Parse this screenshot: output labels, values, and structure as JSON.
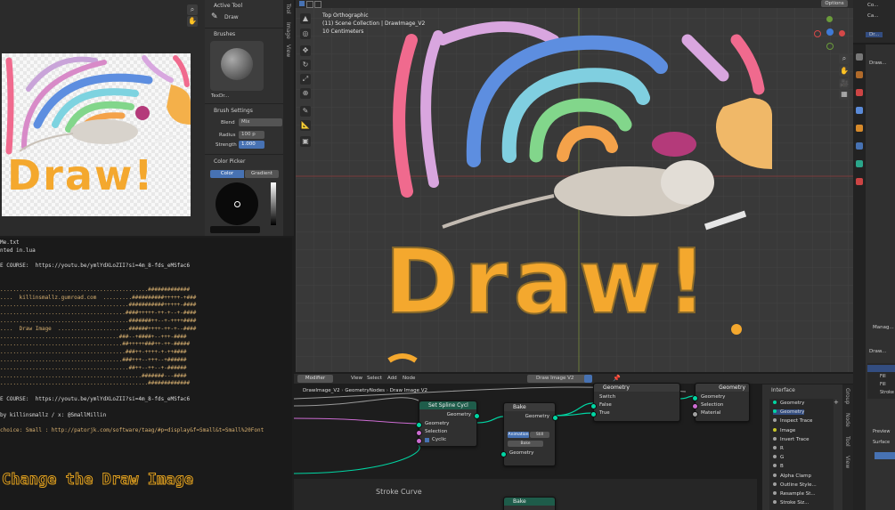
{
  "image_editor": {
    "tools_title": "Active Tool",
    "tool_name": "Draw",
    "brushes_title": "Brushes",
    "brush_name": "TexDr...",
    "brush_settings_title": "Brush Settings",
    "blend_label": "Blend",
    "blend_value": "Mix",
    "radius_label": "Radius",
    "radius_value": "100 p",
    "strength_label": "Strength",
    "strength_value": "1.000",
    "color_picker_title": "Color Picker",
    "color_tab": "Color",
    "gradient_tab": "Gradient",
    "side_tabs": [
      "Tool",
      "Image",
      "View"
    ],
    "canvas_text": "Draw!"
  },
  "terminal": {
    "lines": [
      "Me.txt",
      "nted in.lua",
      "",
      "E COURSE:  https://youtu.be/ymlYdXLoZII?si=4m_8-fds_eMSfac6",
      "",
      "",
      "..............................................#############",
      "....  killinsmallz.gumroad.com  .........##########+++++-+###",
      "........................................###########+++++-####",
      ".......................................####+++++-++-+--+-####",
      "........................................#######++--+-++++####",
      "....  Draw Image  ......................######++++-++-+--####",
      ".....................................###--+####+--+++-####",
      "......................................##+++++###++-++-#####",
      ".......................................###++-++++-+-++####",
      "......................................###+++--+++--+######",
      "........................................##++--++--+-######",
      "............................................#######---####",
      "..............................................#############",
      "",
      "E COURSE:  https://youtu.be/ymlYdXLoZII?si=4m_8-fds_eMSfac6",
      "",
      "by killinsmallz / x: @SmallMillin",
      "",
      "choice: Small : http://patorjk.com/software/taag/#p=display&f=Small&t=Small%20Font"
    ],
    "banner": "Change the Draw Image"
  },
  "viewport": {
    "view_name": "Top Orthographic",
    "collection": "(11) Scene Collection | DrawImage_V2",
    "scale": "10 Centimeters",
    "options_label": "Options",
    "canvas_text": "Draw!"
  },
  "node_editor": {
    "editor_menu": "Modifier",
    "menu_items": [
      "View",
      "Select",
      "Add",
      "Node"
    ],
    "node_group": "Draw Image V2",
    "breadcrumb": [
      "DrawImage_V2",
      "GeometryNodes",
      "Draw Image V2"
    ],
    "nodes": {
      "set_spline_cycle": {
        "title": "Set Spline Cycl",
        "inputs": [
          "Geometry",
          "Selection",
          "Cyclic"
        ],
        "output": "Geometry"
      },
      "bake1": {
        "title": "Bake",
        "output": "Geometry",
        "anim_label": "Animation",
        "still_label": "Still",
        "bake_button": "Bake",
        "input": "Geometry"
      },
      "switch": {
        "title": "Geometry",
        "rows": [
          "Switch",
          "False",
          "True"
        ]
      },
      "join": {
        "title": "Geometry",
        "rows": [
          "Geometry",
          "Selection",
          "Material"
        ]
      },
      "frame_label": "Stroke Curve",
      "bake2": {
        "title": "Bake"
      }
    },
    "interface_title": "Interface",
    "interface_items": [
      "Geometry",
      "Geometry",
      "Inspect Trace",
      "Image",
      "Invert Trace",
      "R",
      "G",
      "B",
      "Alpha Clamp",
      "Outline Style...",
      "Resample St...",
      "Stroke Siz..."
    ],
    "side_tabs": [
      "Group",
      "Node",
      "Tool",
      "View"
    ]
  },
  "properties": {
    "outliner_items": [
      "Co...",
      "Ca...",
      "Dr..."
    ],
    "top_label": "Draw...",
    "fill_items": [
      "Fill",
      "Fill",
      "Stroke"
    ],
    "bottom_label": "Draw...",
    "manage": "Manag...",
    "preview": "Preview",
    "surface": "Surface"
  }
}
